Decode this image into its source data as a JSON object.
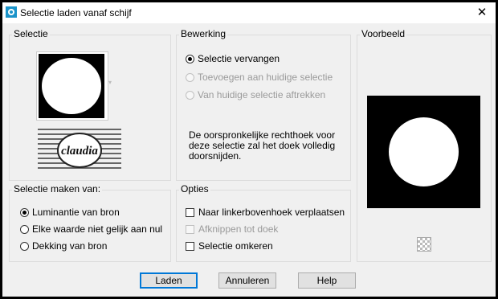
{
  "window": {
    "title": "Selectie laden vanaf schijf",
    "close_symbol": "✕"
  },
  "selectie": {
    "title": "Selectie",
    "thumb_caption": "claudia"
  },
  "bewerking": {
    "title": "Bewerking",
    "options": [
      {
        "label": "Selectie vervangen",
        "checked": true,
        "enabled": true
      },
      {
        "label": "Toevoegen aan huidige selectie",
        "checked": false,
        "enabled": false
      },
      {
        "label": "Van huidige selectie aftrekken",
        "checked": false,
        "enabled": false
      }
    ],
    "description": "De oorspronkelijke rechthoek voor deze selectie zal het doek volledig doorsnijden."
  },
  "voorbeeld": {
    "title": "Voorbeeld"
  },
  "selectie_maken": {
    "title": "Selectie maken van:",
    "options": [
      {
        "label": "Luminantie van bron",
        "checked": true
      },
      {
        "label": "Elke waarde niet gelijk aan nul",
        "checked": false
      },
      {
        "label": "Dekking van bron",
        "checked": false
      }
    ]
  },
  "opties": {
    "title": "Opties",
    "options": [
      {
        "label": "Naar linkerbovenhoek verplaatsen",
        "checked": false,
        "enabled": true
      },
      {
        "label": "Afknippen tot doek",
        "checked": false,
        "enabled": false
      },
      {
        "label": "Selectie omkeren",
        "checked": false,
        "enabled": true
      }
    ]
  },
  "buttons": {
    "load": "Laden",
    "cancel": "Annuleren",
    "help": "Help"
  }
}
